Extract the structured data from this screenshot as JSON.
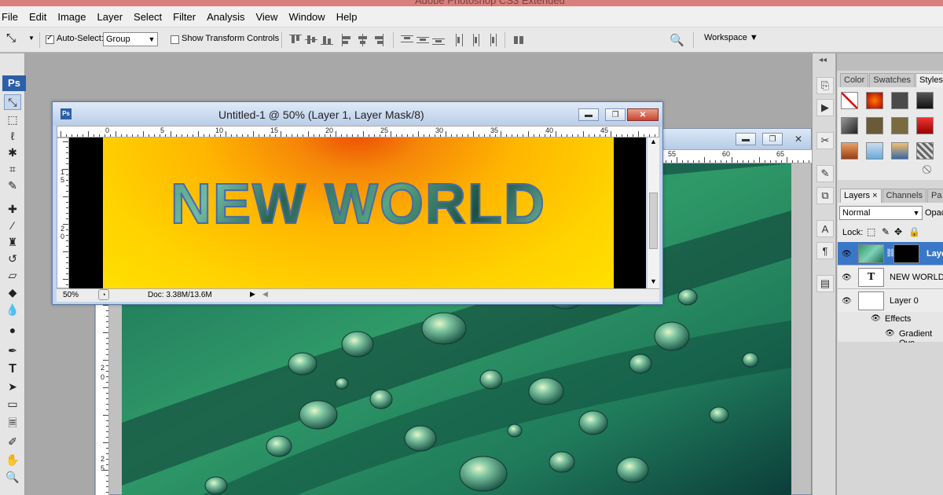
{
  "app": {
    "title": "Adobe Photoshop CS3 Extended",
    "logo": "Ps"
  },
  "menu": [
    "File",
    "Edit",
    "Image",
    "Layer",
    "Select",
    "Filter",
    "Analysis",
    "View",
    "Window",
    "Help"
  ],
  "options": {
    "auto_select_label": "Auto-Select:",
    "auto_select_checked": true,
    "auto_select_value": "Group",
    "transform_label": "Show Transform Controls",
    "transform_checked": false,
    "workspace_label": "Workspace ▼"
  },
  "document": {
    "title": "Untitled-1 @ 50% (Layer 1, Layer Mask/8)",
    "headline": "NEW WORLD",
    "zoom": "50%",
    "doc_info": "Doc: 3.38M/13.6M",
    "ruler_top": [
      "0",
      "5",
      "10",
      "15",
      "20",
      "25",
      "30",
      "35",
      "40",
      "45"
    ],
    "ruler_left": [
      "1",
      "5",
      "2",
      "0"
    ]
  },
  "background_document": {
    "ruler_top": [
      "55",
      "60",
      "65"
    ],
    "ruler_left": [
      "2",
      "0",
      "2",
      "5"
    ]
  },
  "panels": {
    "swatches_tabs": [
      "Color",
      "Swatches",
      "Styles"
    ],
    "layers_tabs": [
      "Layers ×",
      "Channels",
      "Pa"
    ],
    "blend_mode": "Normal",
    "opacity_label": "Opac",
    "lock_label": "Lock:",
    "layers": [
      {
        "name": "Layer",
        "selected": true
      },
      {
        "name": "NEW WORLD",
        "selected": false
      },
      {
        "name": "Layer 0",
        "selected": false
      }
    ],
    "effects_label": "Effects",
    "effect_item": "Gradient Ove"
  },
  "colors": {
    "menu_bg": "#f0f0f0",
    "selection_blue": "#3a77c9",
    "gradient_start": "#ec4a05",
    "gradient_end": "#ffe000",
    "text_fill": "#2f8a55"
  },
  "icons": {
    "toolbox": [
      "move-tool-icon",
      "marquee-tool-icon",
      "lasso-tool-icon",
      "magic-wand-icon",
      "crop-tool-icon",
      "slice-tool-icon",
      "healing-brush-icon",
      "brush-tool-icon",
      "clone-stamp-icon",
      "history-brush-icon",
      "eraser-icon",
      "paint-bucket-icon",
      "blur-tool-icon",
      "dodge-tool-icon",
      "pen-tool-icon",
      "type-tool-icon",
      "path-selection-icon",
      "rectangle-tool-icon",
      "notes-tool-icon",
      "eyedropper-icon",
      "hand-tool-icon",
      "zoom-tool-icon"
    ]
  }
}
